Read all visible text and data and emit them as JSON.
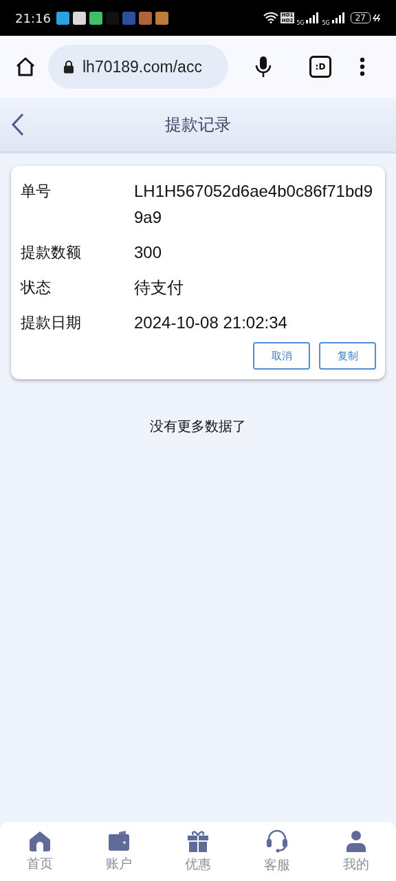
{
  "status_bar": {
    "time": "21:16",
    "app_icons": [
      {
        "color": "#2aa3e0"
      },
      {
        "color": "#d8d8d8"
      },
      {
        "color": "#3fbf6a"
      },
      {
        "color": "#111111"
      },
      {
        "color": "#2c4fa0"
      },
      {
        "color": "#b0643a"
      },
      {
        "color": "#c07a3a"
      }
    ],
    "hd_label": "HD1 HD2",
    "network_1": "5G",
    "network_2": "5G",
    "battery": "27"
  },
  "browser": {
    "url": "lh70189.com/acc",
    "tab_label": ":D"
  },
  "header": {
    "title": "提款记录"
  },
  "record": {
    "fields": [
      {
        "label": "单号",
        "value": "LH1H567052d6ae4b0c86f71bd99a9"
      },
      {
        "label": "提款数额",
        "value": "300"
      },
      {
        "label": "状态",
        "value": "待支付"
      },
      {
        "label": "提款日期",
        "value": "2024-10-08 21:02:34"
      }
    ],
    "buttons": [
      "取消",
      "复制"
    ]
  },
  "end_text": "没有更多数据了",
  "bottom_nav": [
    {
      "kind": "home",
      "label": "首页"
    },
    {
      "kind": "wallet",
      "label": "账户"
    },
    {
      "kind": "gift",
      "label": "优惠"
    },
    {
      "kind": "headset",
      "label": "客服"
    },
    {
      "kind": "user",
      "label": "我的"
    }
  ]
}
